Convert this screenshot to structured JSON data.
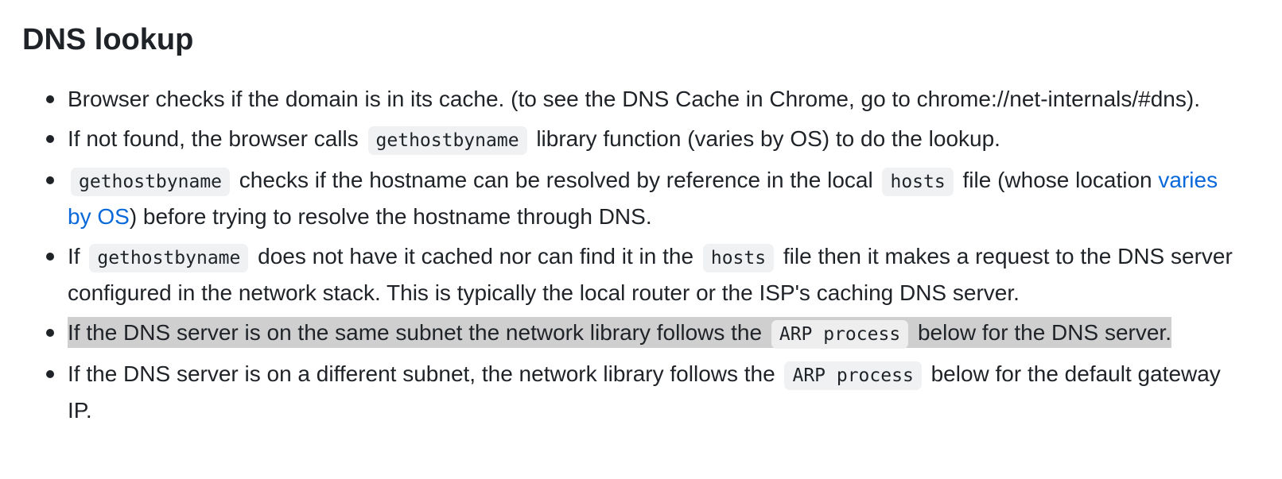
{
  "section": {
    "heading": "DNS lookup"
  },
  "items": [
    {
      "t1": "Browser checks if the domain is in its cache. (to see the DNS Cache in Chrome, go to chrome://net-internals/#dns)."
    },
    {
      "t1": "If not found, the browser calls ",
      "c1": "gethostbyname",
      "t2": " library function (varies by OS) to do the lookup."
    },
    {
      "c1": "gethostbyname",
      "t1": " checks if the hostname can be resolved by reference in the local ",
      "c2": "hosts",
      "t2": " file (whose location ",
      "link": "varies by OS",
      "t3": ") before trying to resolve the hostname through DNS."
    },
    {
      "t1": "If ",
      "c1": "gethostbyname",
      "t2": " does not have it cached nor can find it in the ",
      "c2": "hosts",
      "t3": " file then it makes a request to the DNS server configured in the network stack. This is typically the local router or the ISP's caching DNS server."
    },
    {
      "t1": "If the DNS server is on the same subnet the network library follows the ",
      "c1": "ARP process",
      "t2": " below for the DNS server."
    },
    {
      "t1": "If the DNS server is on a different subnet, the network library follows the ",
      "c1": "ARP process",
      "t2": " below for the default gateway IP."
    }
  ]
}
